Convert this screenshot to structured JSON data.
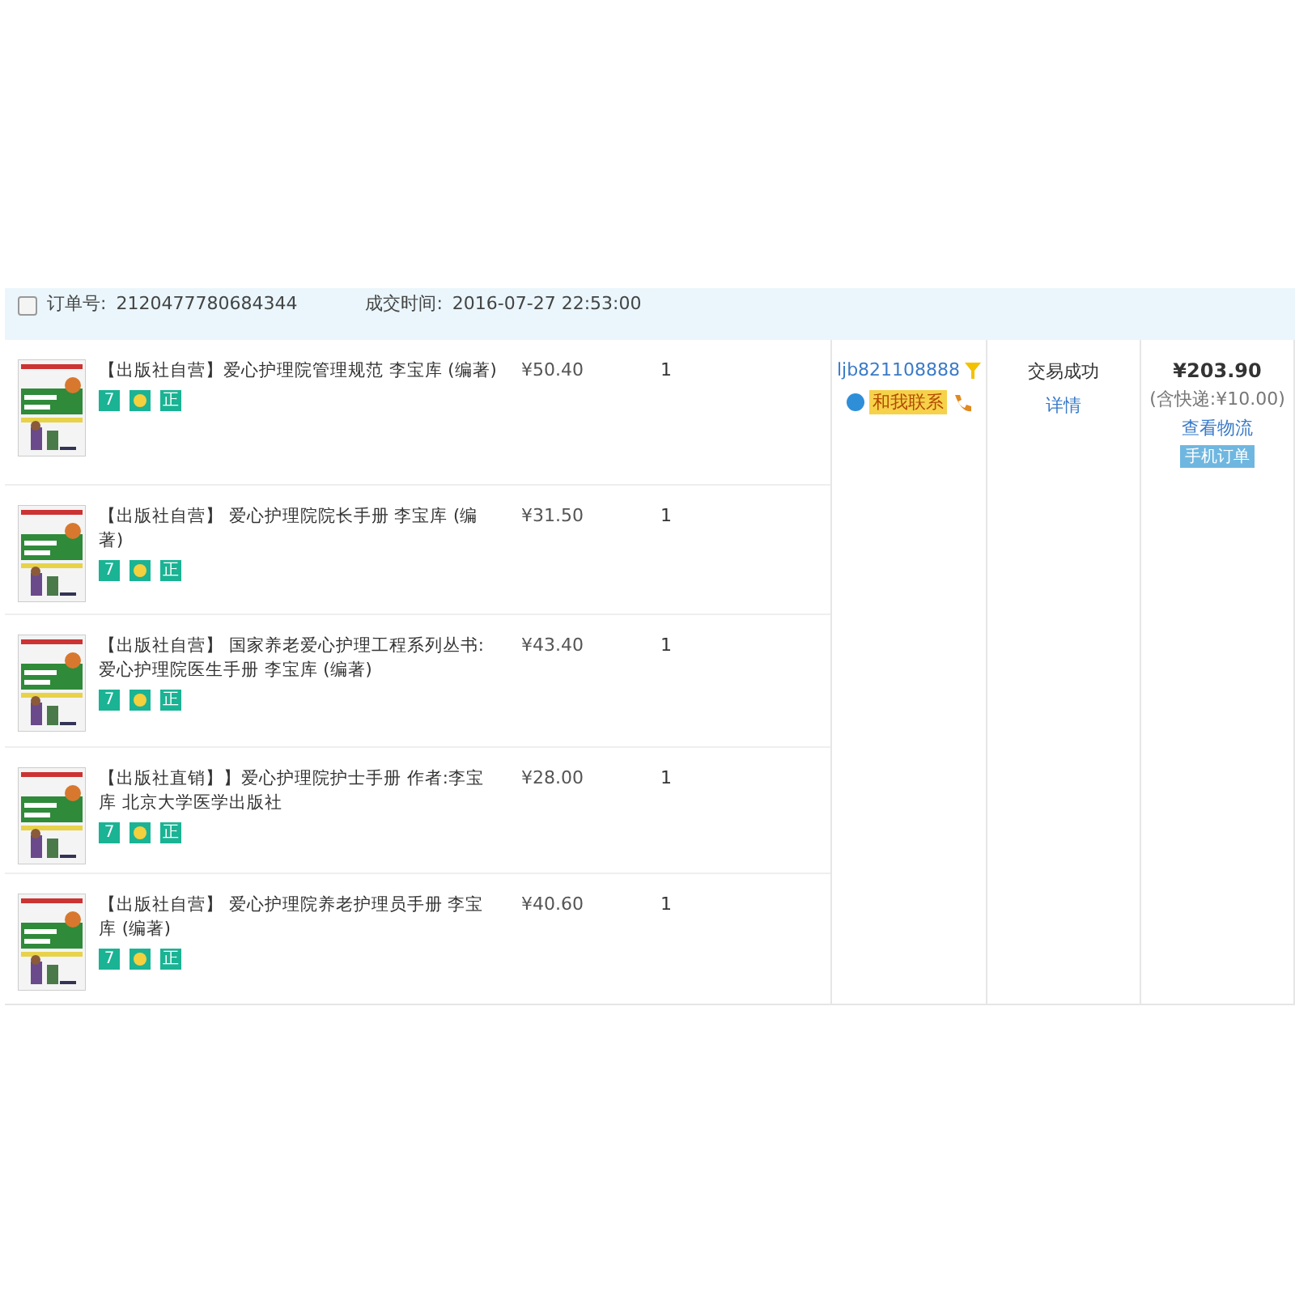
{
  "order": {
    "checked": false,
    "order_label": "订单号:",
    "order_no": "2120477780684344",
    "time_label": "成交时间:",
    "time": "2016-07-27 22:53:00"
  },
  "items": [
    {
      "title": "【出版社自营】爱心护理院管理规范 李宝库 (编著)",
      "price": "¥50.40",
      "qty": "1",
      "badges": [
        "7",
        "正"
      ]
    },
    {
      "title": "【出版社自营】 爱心护理院院长手册 李宝库 (编著)",
      "price": "¥31.50",
      "qty": "1",
      "badges": [
        "7",
        "正"
      ]
    },
    {
      "title": "【出版社自营】 国家养老爱心护理工程系列丛书:爱心护理院医生手册 李宝库 (编著)",
      "price": "¥43.40",
      "qty": "1",
      "badges": [
        "7",
        "正"
      ]
    },
    {
      "title": "【出版社直销】】爱心护理院护士手册 作者:李宝库 北京大学医学出版社",
      "price": "¥28.00",
      "qty": "1",
      "badges": [
        "7",
        "正"
      ]
    },
    {
      "title": "【出版社自营】 爱心护理院养老护理员手册 李宝库 (编著)",
      "price": "¥40.60",
      "qty": "1",
      "badges": [
        "7",
        "正"
      ]
    }
  ],
  "seller": {
    "name": "ljb821108888",
    "contact": "和我联系"
  },
  "status": {
    "text": "交易成功",
    "link": "详情"
  },
  "total": {
    "amount": "¥203.90",
    "shipping": "(含快递:¥10.00)",
    "logistics": "查看物流",
    "mobile_tag": "手机订单"
  }
}
